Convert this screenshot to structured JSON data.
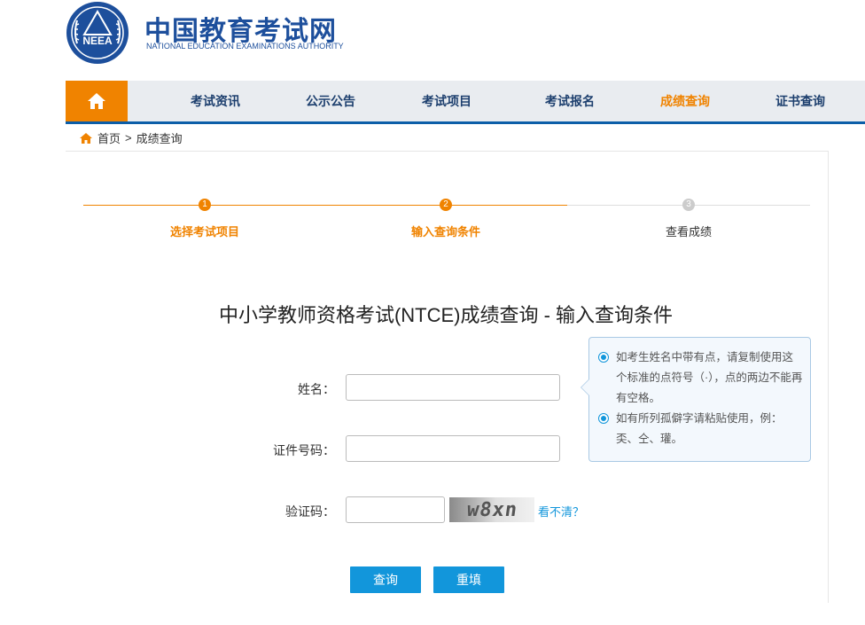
{
  "header": {
    "logo_text": "NEEA",
    "title": "中国教育考试网",
    "subtitle": "NATIONAL EDUCATION EXAMINATIONS AUTHORITY"
  },
  "nav": {
    "items": [
      {
        "label": "考试资讯"
      },
      {
        "label": "公示公告"
      },
      {
        "label": "考试项目"
      },
      {
        "label": "考试报名"
      },
      {
        "label": "成绩查询"
      },
      {
        "label": "证书查询"
      }
    ],
    "active": "成绩查询"
  },
  "breadcrumb": {
    "home": "首页",
    "separator": ">",
    "current": "成绩查询"
  },
  "steps": [
    {
      "number": "1",
      "label": "选择考试项目",
      "state": "done"
    },
    {
      "number": "2",
      "label": "输入查询条件",
      "state": "current"
    },
    {
      "number": "3",
      "label": "查看成绩",
      "state": "pending"
    }
  ],
  "page_title": "中小学教师资格考试(NTCE)成绩查询 - 输入查询条件",
  "form": {
    "name_label": "姓名：",
    "name_value": "",
    "id_label": "证件号码：",
    "id_value": "",
    "captcha_label": "验证码：",
    "captcha_value": "",
    "captcha_text": "w8xn",
    "captcha_refresh": "看不清？"
  },
  "hints": [
    "如考生姓名中带有点，请复制使用这个标准的点符号（·），点的两边不能再有空格。",
    "如有所列孤僻字请粘贴使用，例：奀、仝、瓘。"
  ],
  "buttons": {
    "query": "查询",
    "reset": "重填"
  },
  "colors": {
    "brand_blue": "#1d4f9c",
    "accent_orange": "#f08300",
    "button_blue": "#1296db",
    "nav_bg": "#e9ecf0",
    "pending_grey": "#cccccc"
  }
}
